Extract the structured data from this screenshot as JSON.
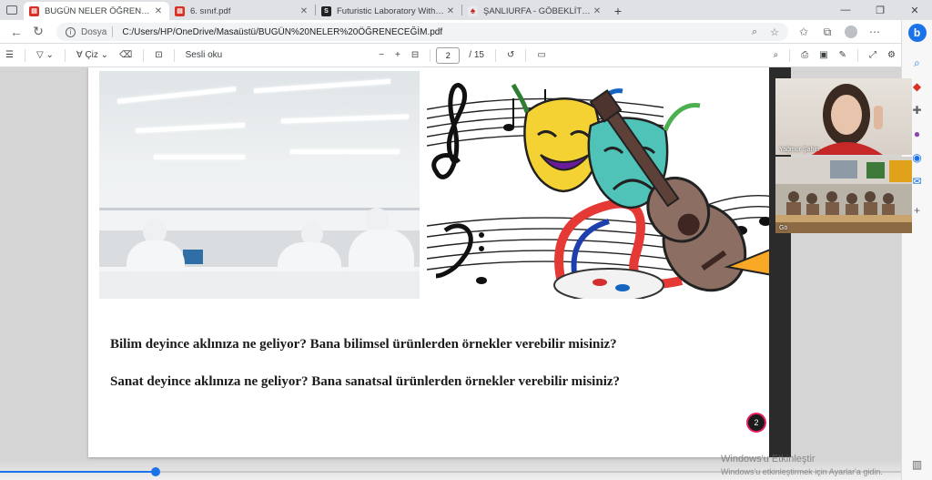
{
  "tabs": [
    {
      "title": "BUGÜN NELER ÖĞRENECEĞİM.pdf",
      "icon": "pdf-icon",
      "active": true
    },
    {
      "title": "6. sınıf.pdf",
      "icon": "pdf-icon",
      "active": false
    },
    {
      "title": "Futuristic Laboratory With Divers",
      "icon": "s-icon",
      "active": false
    },
    {
      "title": "ŞANLIURFA - GÖBEKLİTEPE ÖREN",
      "icon": "web-icon",
      "active": false
    }
  ],
  "address": {
    "protocol_label": "Dosya",
    "url": "C:/Users/HP/OneDrive/Masaüstü/BUGÜN%20NELER%20ÖĞRENECEĞİM.pdf"
  },
  "pdf_toolbar": {
    "draw_label": "Çiz",
    "read_aloud_label": "Sesli oku",
    "current_page": "2",
    "total_pages": "/ 15"
  },
  "page": {
    "question_1": "Bilim deyince aklınıza ne geliyor? Bana bilimsel ürünlerden örnekler verebilir misiniz?",
    "question_2": "Sanat deyince aklınıza ne geliyor? Bana sanatsal ürünlerden örnekler verebilir misiniz?"
  },
  "video": {
    "participant_1": "Yağmur Şahin",
    "participant_2": "Gö"
  },
  "badge_count": "2",
  "watermark": {
    "line1": "Windows'u Etkinleştir",
    "line2": "Windows'u etkinleştirmek için Ayarlar'a gidin."
  },
  "colors": {
    "accent": "#1a73e8",
    "pdf_red": "#d93025",
    "badge_ring": "#e91e63"
  }
}
